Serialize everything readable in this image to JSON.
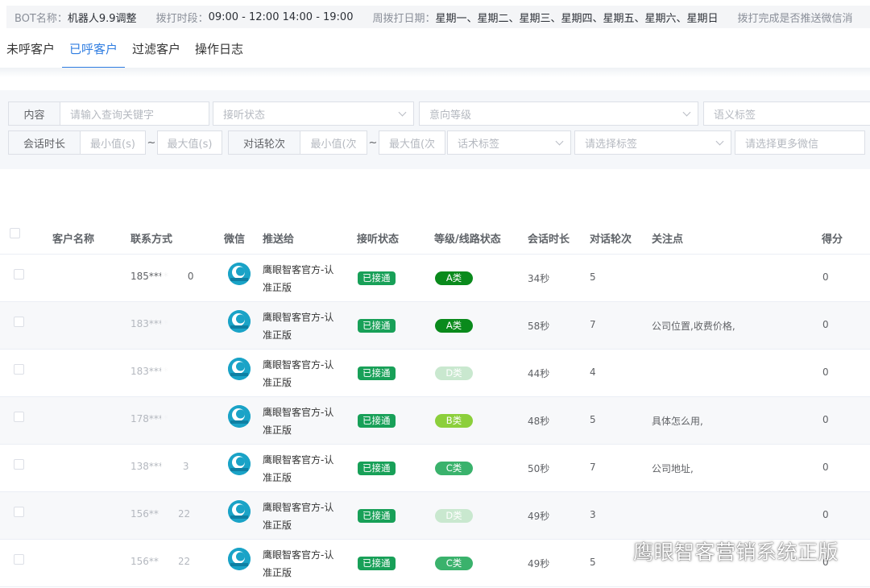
{
  "infobar": {
    "bot_label": "BOT名称：",
    "bot_value": "机器人9.9调整",
    "time_label": "拨打时段：",
    "time_value": "09:00 - 12:00 14:00 - 19:00",
    "week_label": "周拨打日期：",
    "week_value": "星期一、星期二、星期三、星期四、星期五、星期六、星期日",
    "push_label": "拨打完成是否推送微信消"
  },
  "tabs": [
    {
      "label": "未呼客户"
    },
    {
      "label": "已呼客户"
    },
    {
      "label": "过滤客户"
    },
    {
      "label": "操作日志"
    }
  ],
  "active_tab": "已呼客户",
  "filters": {
    "content_label": "内容",
    "content_placeholder": "请输入查询关键字",
    "answer_status_placeholder": "接听状态",
    "intent_level_placeholder": "意向等级",
    "semantic_tag_placeholder": "语义标签",
    "duration_label": "会话时长",
    "duration_min": "最小值(s)",
    "duration_max": "最大值(s)",
    "range_sep": "~",
    "rounds_label": "对话轮次",
    "rounds_min": "最小值(次",
    "rounds_max": "最大值(次",
    "script_tag_placeholder": "话术标签",
    "tag_placeholder": "请选择标签",
    "wechat_placeholder": "请选择更多微信"
  },
  "table": {
    "headers": {
      "name": "客户名称",
      "contact": "联系方式",
      "wechat": "微信",
      "push_to": "推送给",
      "answer_status": "接听状态",
      "grade": "等级/线路状态",
      "duration": "会话时长",
      "rounds": "对话轮次",
      "focus": "关注点",
      "score": "得分"
    },
    "rows": [
      {
        "contact": "185****",
        "contact_tail": "0",
        "push_line1": "鹰眼智客官方-认",
        "push_line2": "准正版",
        "status": "已接通",
        "grade": "A类",
        "duration": "34秒",
        "rounds": "5",
        "focus": "",
        "score": "0"
      },
      {
        "contact": "183****",
        "contact_tail": "",
        "push_line1": "鹰眼智客官方-认",
        "push_line2": "准正版",
        "status": "已接通",
        "grade": "A类",
        "duration": "58秒",
        "rounds": "7",
        "focus": "公司位置,收费价格,",
        "score": "0"
      },
      {
        "contact": "183****",
        "contact_tail": "",
        "push_line1": "鹰眼智客官方-认",
        "push_line2": "准正版",
        "status": "已接通",
        "grade": "D类",
        "duration": "44秒",
        "rounds": "4",
        "focus": "",
        "score": "0"
      },
      {
        "contact": "178****",
        "contact_tail": "",
        "push_line1": "鹰眼智客官方-认",
        "push_line2": "准正版",
        "status": "已接通",
        "grade": "B类",
        "duration": "48秒",
        "rounds": "5",
        "focus": "具体怎么用,",
        "score": "0"
      },
      {
        "contact": "138***",
        "contact_tail": "3",
        "push_line1": "鹰眼智客官方-认",
        "push_line2": "准正版",
        "status": "已接通",
        "grade": "C类",
        "duration": "50秒",
        "rounds": "7",
        "focus": "公司地址,",
        "score": "0"
      },
      {
        "contact": "156**",
        "contact_tail": "22",
        "push_line1": "鹰眼智客官方-认",
        "push_line2": "准正版",
        "status": "已接通",
        "grade": "D类",
        "duration": "49秒",
        "rounds": "3",
        "focus": "",
        "score": "0"
      },
      {
        "contact": "156**",
        "contact_tail": "22",
        "push_line1": "鹰眼智客官方-认",
        "push_line2": "准正版",
        "status": "已接通",
        "grade": "C类",
        "duration": "49秒",
        "rounds": "5",
        "focus": "",
        "score": "0"
      }
    ]
  },
  "grade_colors": {
    "A类": "#0a8a1c",
    "B类": "#8ccf3b",
    "C类": "#3ab26c",
    "D类": "#c9e8cf"
  },
  "status_color": "#18a058",
  "accent_color": "#2f7de1",
  "watermark": {
    "text": "鹰眼智客营销系统正版",
    "icon": "wechat-official-account-icon"
  }
}
